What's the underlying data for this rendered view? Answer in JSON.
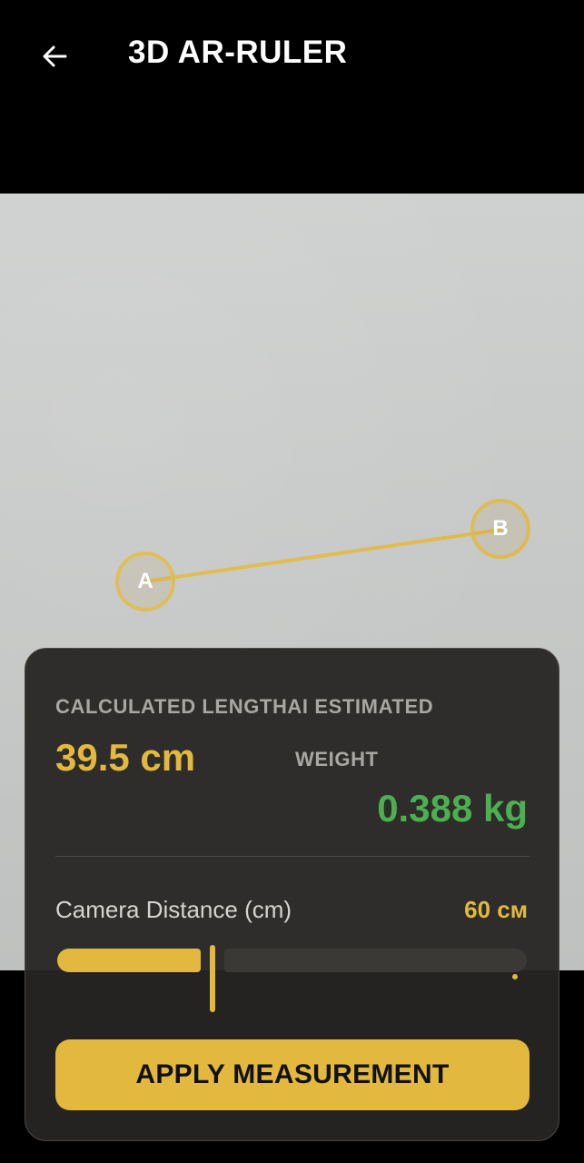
{
  "header": {
    "back_icon": "arrow-left-icon",
    "title": "3D AR-RULER"
  },
  "measurement": {
    "point_a_label": "A",
    "point_b_label": "B",
    "accent_color": "#e2b93e"
  },
  "panel": {
    "length_label": "CALCULATED LENGTHAI ESTIMATED",
    "length_value": "39.5 cm",
    "weight_label": "WEIGHT",
    "weight_value": "0.388 kg",
    "distance_label": "Camera Distance (cm)",
    "distance_value": "60 см",
    "slider_fraction": 0.33,
    "apply_label": "APPLY MEASUREMENT"
  },
  "colors": {
    "accent": "#e2b93e",
    "weight": "#4caf50",
    "panel_bg": "#262523"
  }
}
